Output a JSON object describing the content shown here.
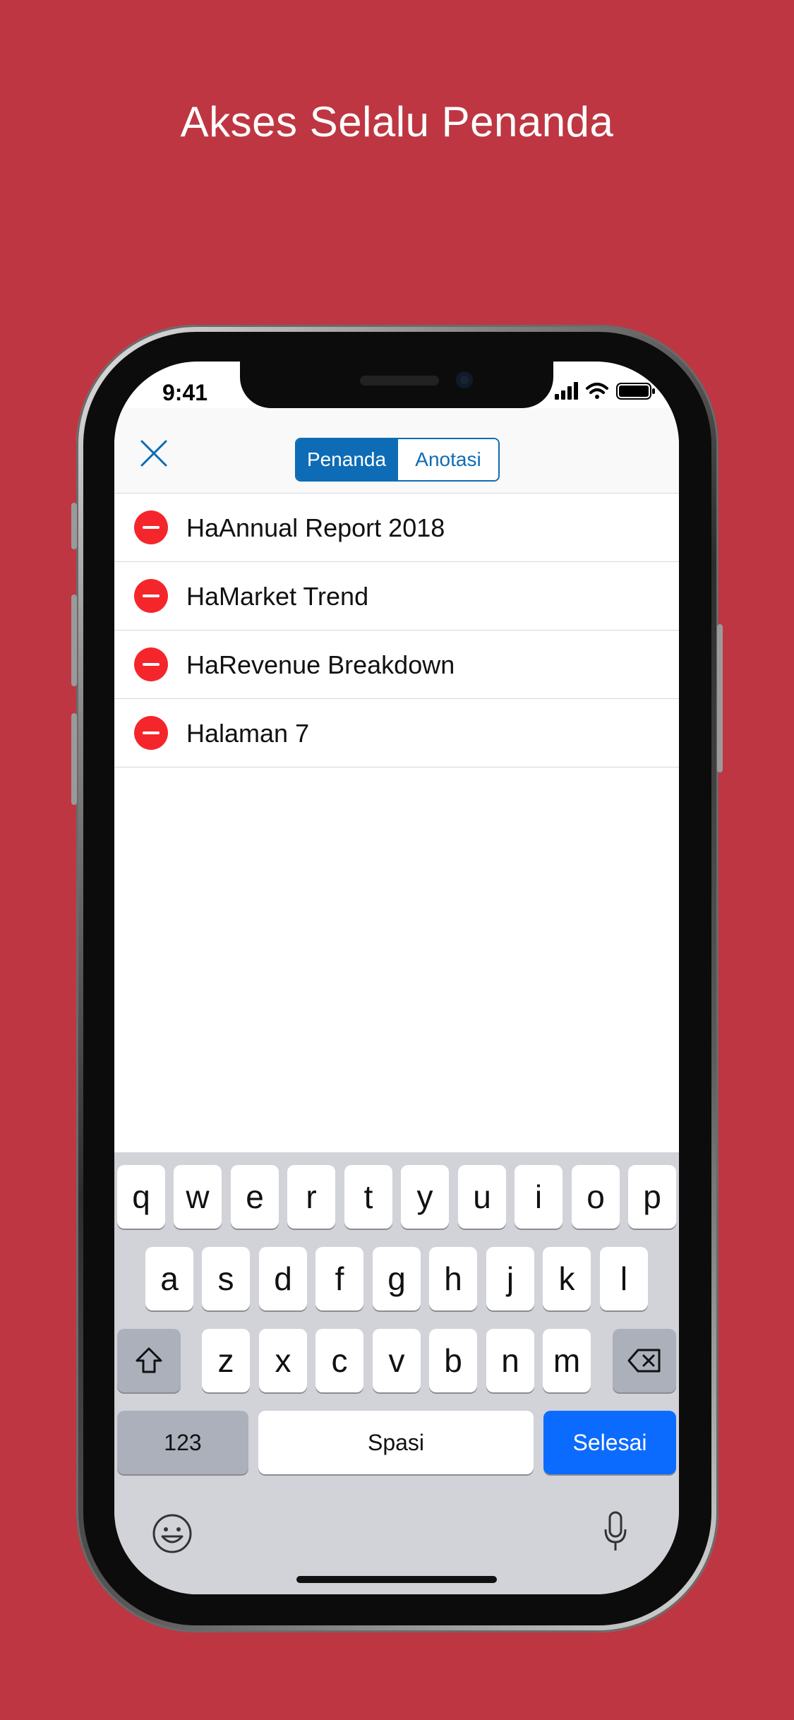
{
  "page": {
    "headline": "Akses Selalu Penanda",
    "background_color": "#BE3642"
  },
  "status_bar": {
    "time": "9:41",
    "icons": [
      "signal-icon",
      "wifi-icon",
      "battery-icon"
    ]
  },
  "navbar": {
    "close_icon": "close-icon",
    "tabs": [
      {
        "label": "Penanda",
        "selected": true
      },
      {
        "label": "Anotasi",
        "selected": false
      }
    ],
    "accent_color": "#0d6cb5"
  },
  "bookmarks": [
    {
      "label": "HaAnnual Report 2018"
    },
    {
      "label": "HaMarket Trend"
    },
    {
      "label": "HaRevenue Breakdown"
    },
    {
      "label": "Halaman 7"
    }
  ],
  "keyboard": {
    "row1": [
      "q",
      "w",
      "e",
      "r",
      "t",
      "y",
      "u",
      "i",
      "o",
      "p"
    ],
    "row2": [
      "a",
      "s",
      "d",
      "f",
      "g",
      "h",
      "j",
      "k",
      "l"
    ],
    "row3": [
      "z",
      "x",
      "c",
      "v",
      "b",
      "n",
      "m"
    ],
    "numbers_key": "123",
    "space_key": "Spasi",
    "done_key": "Selesai",
    "done_color": "#0c6bff"
  }
}
